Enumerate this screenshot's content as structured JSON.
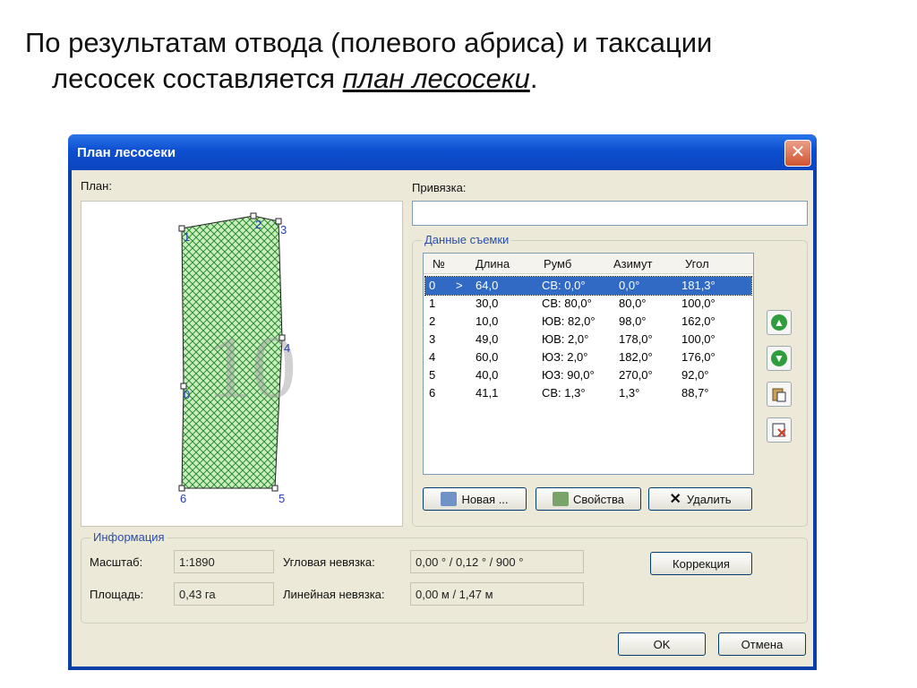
{
  "slide": {
    "line1": "По результатам отвода (полевого абриса) и таксации",
    "line2_plain": "лесосек составляется ",
    "line2_emph": "план лесосеки",
    "line2_end": "."
  },
  "window": {
    "title": "План лесосеки",
    "close_glyph": "✕"
  },
  "plan": {
    "label": "План:",
    "watermark": "10",
    "vertex_labels": [
      "0",
      "1",
      "2",
      "3",
      "4",
      "5",
      "6"
    ]
  },
  "binding": {
    "label": "Привязка:",
    "value": ""
  },
  "survey": {
    "group_title": "Данные съемки",
    "columns": [
      "№",
      "Длина",
      "Румб",
      "Азимут",
      "Угол"
    ],
    "rows": [
      {
        "n": "0",
        "marker": ">",
        "length": "64,0",
        "rhumb": "СВ: 0,0°",
        "azimuth": "0,0°",
        "angle": "181,3°"
      },
      {
        "n": "1",
        "marker": "",
        "length": "30,0",
        "rhumb": "СВ: 80,0°",
        "azimuth": "80,0°",
        "angle": "100,0°"
      },
      {
        "n": "2",
        "marker": "",
        "length": "10,0",
        "rhumb": "ЮВ: 82,0°",
        "azimuth": "98,0°",
        "angle": "162,0°"
      },
      {
        "n": "3",
        "marker": "",
        "length": "49,0",
        "rhumb": "ЮВ: 2,0°",
        "azimuth": "178,0°",
        "angle": "100,0°"
      },
      {
        "n": "4",
        "marker": "",
        "length": "60,0",
        "rhumb": "ЮЗ: 2,0°",
        "azimuth": "182,0°",
        "angle": "176,0°"
      },
      {
        "n": "5",
        "marker": "",
        "length": "40,0",
        "rhumb": "ЮЗ: 90,0°",
        "azimuth": "270,0°",
        "angle": "92,0°"
      },
      {
        "n": "6",
        "marker": "",
        "length": "41,1",
        "rhumb": "СВ: 1,3°",
        "azimuth": "1,3°",
        "angle": "88,7°"
      }
    ],
    "selected_row": 0,
    "buttons": {
      "new": "Новая ...",
      "properties": "Свойства",
      "delete": "Удалить"
    },
    "side_buttons": [
      "arrow-up-icon",
      "arrow-down-icon",
      "paste-icon",
      "delete-row-icon"
    ]
  },
  "info": {
    "group_title": "Информация",
    "scale_label": "Масштаб:",
    "scale_value": "1:1890",
    "area_label": "Площадь:",
    "area_value": "0,43 га",
    "angular_label": "Угловая невязка:",
    "angular_value": "0,00 ° / 0,12 ° / 900 °",
    "linear_label": "Линейная невязка:",
    "linear_value": "0,00 м / 1,47 м",
    "correction": "Коррекция"
  },
  "footer": {
    "ok": "OK",
    "cancel": "Отмена"
  },
  "colors": {
    "titlebar": "#0d4fd0",
    "selection": "#316ac5",
    "hatch": "#2e8b2e",
    "hatch_bg": "#c9efc0"
  }
}
